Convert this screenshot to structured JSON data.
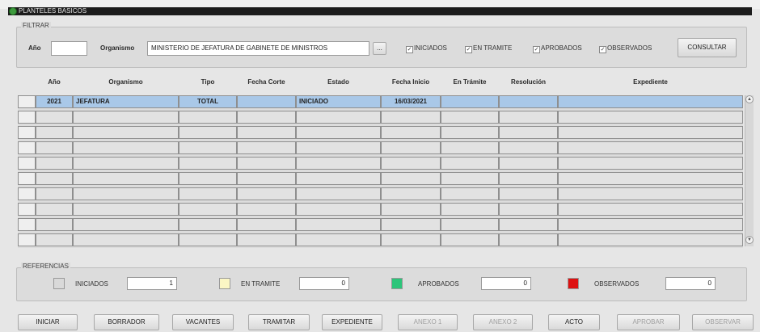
{
  "window": {
    "title": "PLANTELES BASICOS"
  },
  "filter": {
    "group_label": "FILTRAR",
    "year_label": "Año",
    "year_value": "",
    "org_label": "Organismo",
    "org_value": "MINISTERIO DE JEFATURA DE GABINETE DE MINISTROS",
    "lookup_label": "...",
    "checks": [
      {
        "label": "INICIADOS",
        "checked": true
      },
      {
        "label": "EN TRAMITE",
        "checked": true
      },
      {
        "label": "APROBADOS",
        "checked": true
      },
      {
        "label": "OBSERVADOS",
        "checked": true
      }
    ],
    "consult_label": "CONSULTAR"
  },
  "table": {
    "columns": [
      "Año",
      "Organismo",
      "Tipo",
      "Fecha Corte",
      "Estado",
      "Fecha Inicio",
      "En Trámite",
      "Resolución",
      "Expediente"
    ],
    "rows": [
      [
        "2021",
        "JEFATURA",
        "TOTAL",
        "",
        "INICIADO",
        "16/03/2021",
        "",
        "",
        ""
      ]
    ],
    "empty_rows": 9
  },
  "references": {
    "group_label": "REFERENCIAS",
    "items": [
      {
        "label": "INICIADOS",
        "color": "#d9d9d9",
        "count": "1"
      },
      {
        "label": "EN TRAMITE",
        "color": "#fbf6c4",
        "count": "0"
      },
      {
        "label": "APROBADOS",
        "color": "#2cc57a",
        "count": "0"
      },
      {
        "label": "OBSERVADOS",
        "color": "#dd1111",
        "count": "0"
      }
    ]
  },
  "actions": [
    {
      "label": "INICIAR",
      "enabled": true
    },
    {
      "label": "BORRADOR",
      "enabled": true
    },
    {
      "label": "VACANTES",
      "enabled": true
    },
    {
      "label": "TRAMITAR",
      "enabled": true
    },
    {
      "label": "EXPEDIENTE",
      "enabled": true
    },
    {
      "label": "ANEXO 1",
      "enabled": false
    },
    {
      "label": "ANEXO 2",
      "enabled": false
    },
    {
      "label": "ACTO",
      "enabled": true
    },
    {
      "label": "APROBAR",
      "enabled": false
    },
    {
      "label": "OBSERVAR",
      "enabled": false
    }
  ],
  "icons": {
    "app": "app-globe-icon",
    "scroll_up": "scroll-up-icon",
    "scroll_down": "scroll-down-icon"
  }
}
